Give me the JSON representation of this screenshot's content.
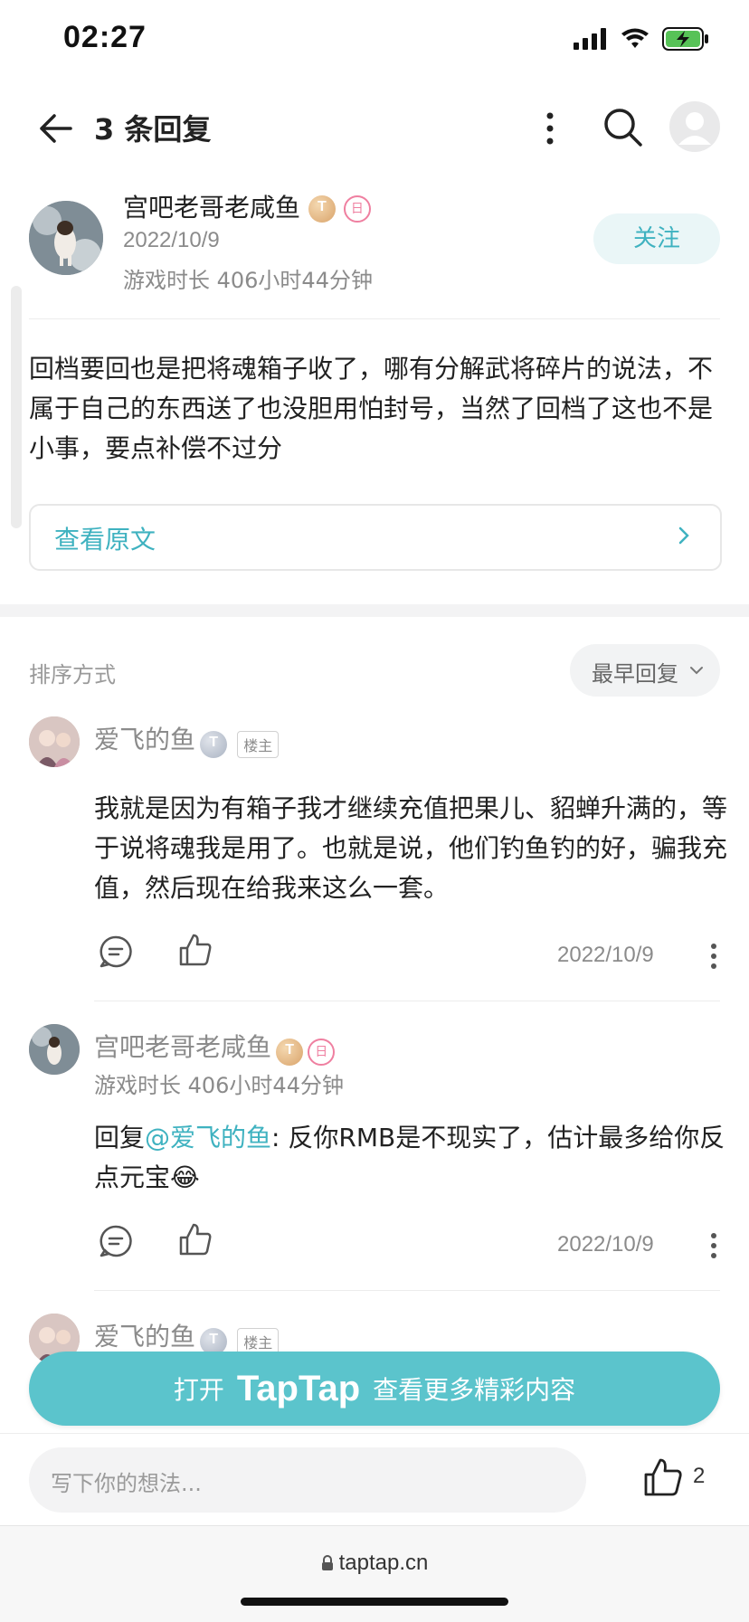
{
  "status_bar": {
    "time": "02:27"
  },
  "header": {
    "title": "3 条回复"
  },
  "author": {
    "name": "宫吧老哥老咸鱼",
    "level_badge": "T",
    "tag_badge": "日",
    "date": "2022/10/9",
    "playtime": "游戏时长 406小时44分钟",
    "follow_label": "关注"
  },
  "post": {
    "body": "回档要回也是把将魂箱子收了，哪有分解武将碎片的说法，不属于自己的东西送了也没胆用怕封号，当然了回档了这也不是小事，要点补偿不过分",
    "view_original_label": "查看原文"
  },
  "sort": {
    "label": "排序方式",
    "selected": "最早回复"
  },
  "comments": [
    {
      "name": "爱飞的鱼",
      "badge": "T",
      "tag": "楼主",
      "text": "我就是因为有箱子我才继续充值把果儿、貂蝉升满的，等于说将魂我是用了。也就是说，他们钓鱼钓的好，骗我充值，然后现在给我来这么一套。",
      "date": "2022/10/9"
    },
    {
      "name": "宫吧老哥老咸鱼",
      "badge": "T",
      "tag_badge": "日",
      "playtime": "游戏时长 406小时44分钟",
      "reply_prefix": "回复",
      "mention": "@爱飞的鱼",
      "text": ": 反你RMB是不现实了，估计最多给你反点元宝😂",
      "date": "2022/10/9"
    },
    {
      "name": "爱飞的鱼",
      "badge": "T",
      "tag": "楼主"
    }
  ],
  "banner": {
    "prefix": "打开",
    "brand": "TapTap",
    "suffix": "查看更多精彩内容"
  },
  "composer": {
    "placeholder": "写下你的想法...",
    "like_count": "2"
  },
  "browser": {
    "url": "taptap.cn"
  },
  "colors": {
    "accent": "#3fb2c0",
    "banner": "#5bc4cc"
  }
}
